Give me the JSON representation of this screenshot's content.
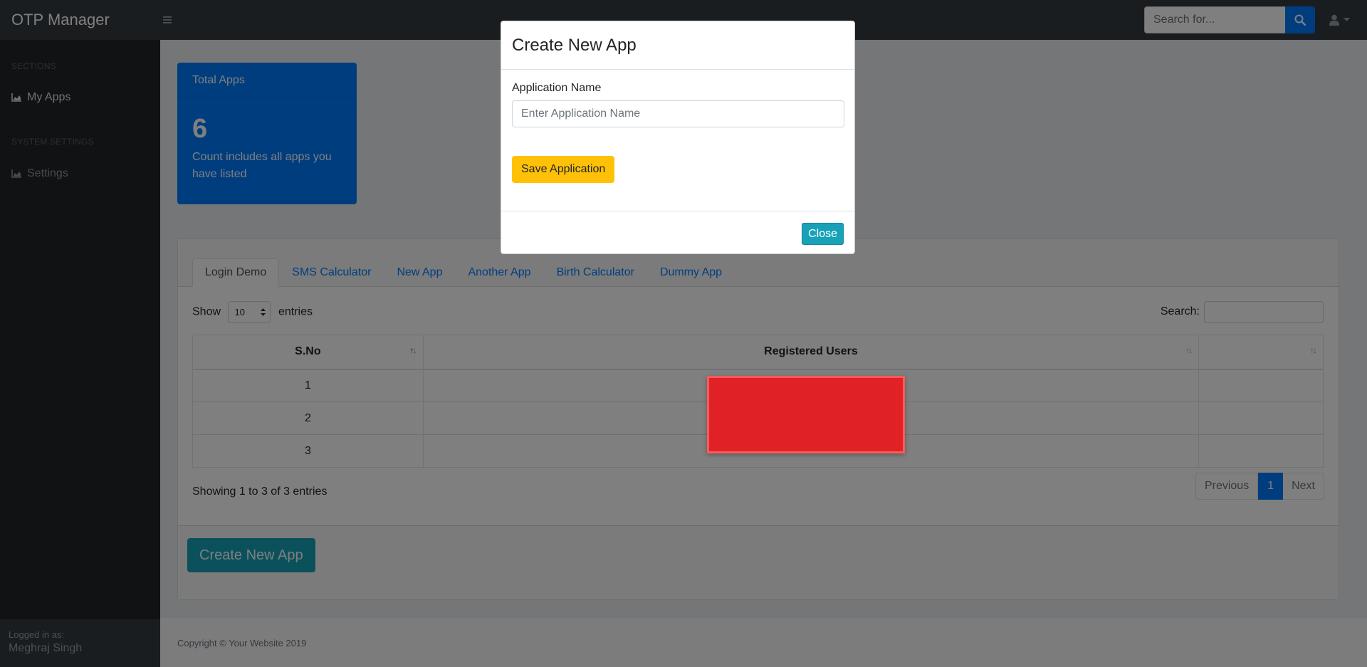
{
  "navbar": {
    "brand": "OTP Manager",
    "search_placeholder": "Search for...",
    "icons": [
      "bars-icon",
      "search-icon",
      "user-icon",
      "caret-down-icon"
    ]
  },
  "sidebar": {
    "sections_heading": "SECTIONS",
    "my_apps": "My Apps",
    "system_heading": "SYSTEM SETTINGS",
    "settings": "Settings",
    "logged_in_label": "Logged in as:",
    "user_name": "Meghraj Singh"
  },
  "stat_card": {
    "title": "Total Apps",
    "count": "6",
    "description": "Count includes all apps you have listed"
  },
  "tabs": [
    {
      "label": "Login Demo",
      "active": true
    },
    {
      "label": "SMS Calculator",
      "active": false
    },
    {
      "label": "New App",
      "active": false
    },
    {
      "label": "Another App",
      "active": false
    },
    {
      "label": "Birth Calculator",
      "active": false
    },
    {
      "label": "Dummy App",
      "active": false
    }
  ],
  "datatable": {
    "show_label": "Show",
    "entries_value": "10",
    "entries_label": "entries",
    "search_label": "Search:",
    "columns": [
      "S.No",
      "Registered Users",
      ""
    ],
    "rows": [
      {
        "sno": "1",
        "user": "",
        "extra": ""
      },
      {
        "sno": "2",
        "user": "",
        "extra": ""
      },
      {
        "sno": "3",
        "user": "",
        "extra": ""
      }
    ],
    "info": "Showing 1 to 3 of 3 entries",
    "prev": "Previous",
    "current_page": "1",
    "next": "Next"
  },
  "create_button": "Create New App",
  "footer": {
    "copyright": "Copyright © Your Website 2019"
  },
  "modal": {
    "title": "Create New App",
    "field_label": "Application Name",
    "field_placeholder": "Enter Application Name",
    "field_value": "",
    "save_label": "Save Application",
    "close_label": "Close"
  },
  "colors": {
    "navbar": "#343a40",
    "sidebar": "#212529",
    "primary": "#007bff",
    "info": "#17a2b8",
    "warning": "#ffc107",
    "redaction": "#e02227"
  }
}
